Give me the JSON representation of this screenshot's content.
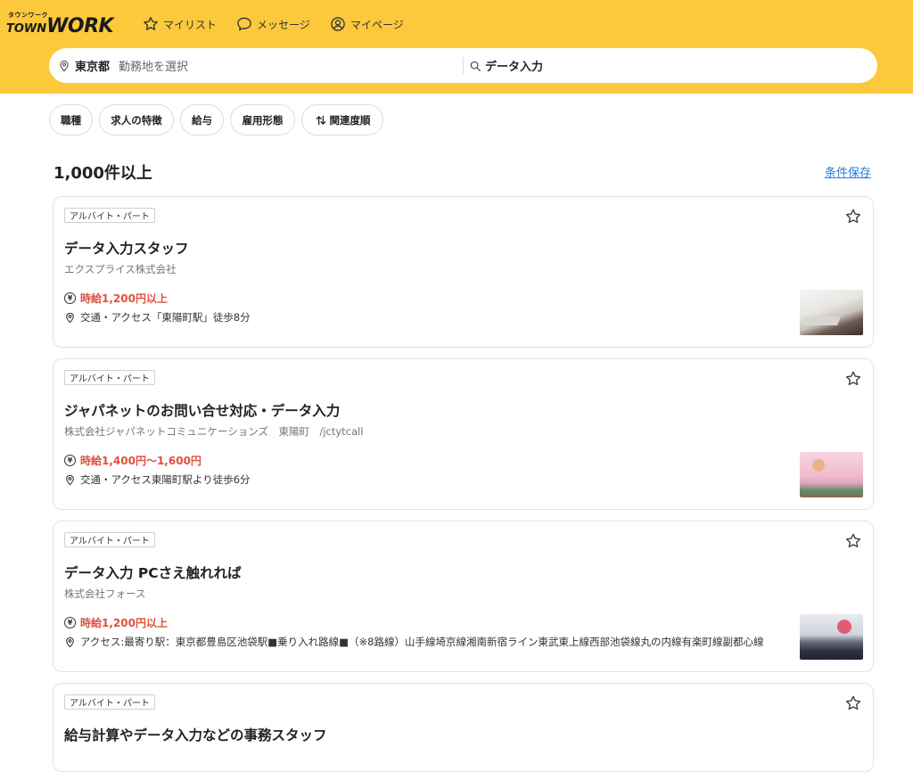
{
  "header": {
    "logo_kana": "タウンワーク",
    "logo_town": "TOWN",
    "logo_work": "WORK",
    "nav": {
      "mylist": "マイリスト",
      "message": "メッセージ",
      "mypage": "マイページ"
    },
    "search": {
      "prefecture": "東京都",
      "place_placeholder": "勤務地を選択",
      "keyword": "データ入力"
    }
  },
  "filters": [
    "職種",
    "求人の特徴",
    "給与",
    "雇用形態",
    "関連度順"
  ],
  "results": {
    "count": "1,000件以上",
    "save_label": "条件保存"
  },
  "jobs": [
    {
      "badge": "アルバイト・パート",
      "title": "データ入力スタッフ",
      "company": "エクスプライス株式会社",
      "wage": "時給1,200円以上",
      "access": "交通・アクセス「東陽町駅」徒歩8分"
    },
    {
      "badge": "アルバイト・パート",
      "title": "ジャパネットのお問い合せ対応・データ入力",
      "company": "株式会社ジャパネットコミュニケーションズ　東陽町　/jctytcall",
      "wage": "時給1,400円〜1,600円",
      "access": "交通・アクセス東陽町駅より徒歩6分"
    },
    {
      "badge": "アルバイト・パート",
      "title": "データ入力 PCさえ触れれば",
      "company": "株式会社フォース",
      "wage": "時給1,200円以上",
      "access": "アクセス:最寄り駅：東京都豊島区池袋駅■乗り入れ路線■（※8路線）山手線埼京線湘南新宿ライン東武東上線西部池袋線丸の内線有楽町線副都心線"
    },
    {
      "badge": "アルバイト・パート",
      "title": "給与計算やデータ入力などの事務スタッフ"
    }
  ],
  "icons": {
    "nav_mylist": "star-outline-icon",
    "nav_message": "speech-bubble-icon",
    "nav_mypage": "user-circle-icon",
    "location": "map-pin-icon",
    "search": "magnifier-icon",
    "sort": "sort-arrows-icon",
    "wage": "yen-circle-icon",
    "favorite": "star-outline-icon"
  },
  "colors": {
    "header_bg": "#fcc93c",
    "wage_text": "#e0503c",
    "link": "#2a7ad2"
  }
}
